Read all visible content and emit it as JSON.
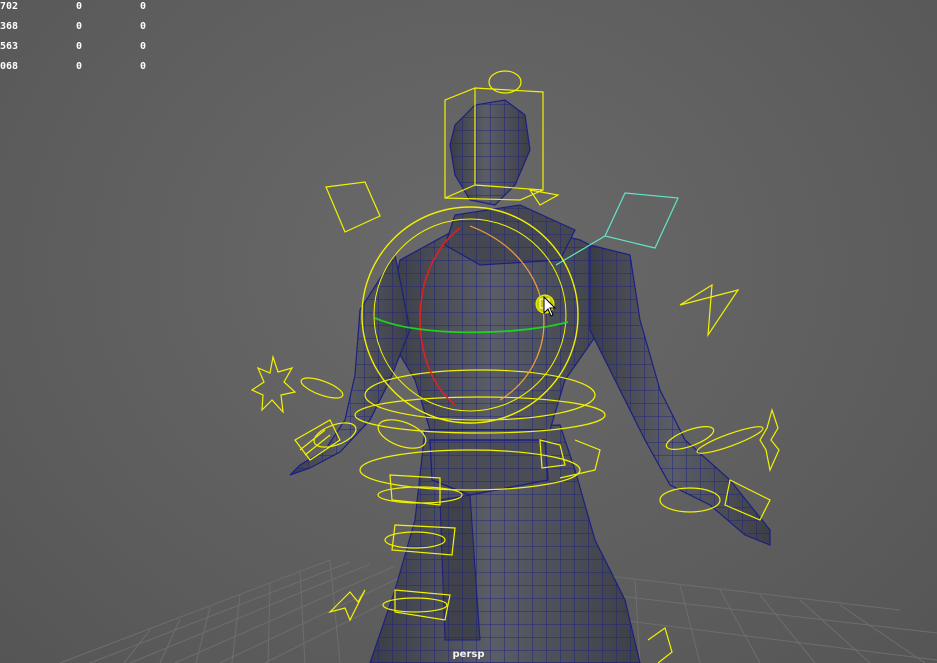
{
  "hud": {
    "rows": [
      {
        "c1": "702",
        "c2": "0",
        "c3": "0"
      },
      {
        "c1": "368",
        "c2": "0",
        "c3": "0"
      },
      {
        "c1": "563",
        "c2": "0",
        "c3": "0"
      },
      {
        "c1": "068",
        "c2": "0",
        "c3": "0"
      }
    ]
  },
  "viewport": {
    "camera": "persp"
  },
  "colors": {
    "background": "#5e5e5e",
    "mesh_fill": "#4a4d55",
    "wireframe": "#1c1f80",
    "controls": "#f2f200",
    "selected_control": "#5fe6c8",
    "rotate_x_axis": "#e02020",
    "rotate_y_axis": "#20d020",
    "rotate_z_axis": "#f2a040"
  },
  "icons": {
    "cursor": "arrow-cursor-icon",
    "manipulator": "rotate-manipulator-icon"
  }
}
